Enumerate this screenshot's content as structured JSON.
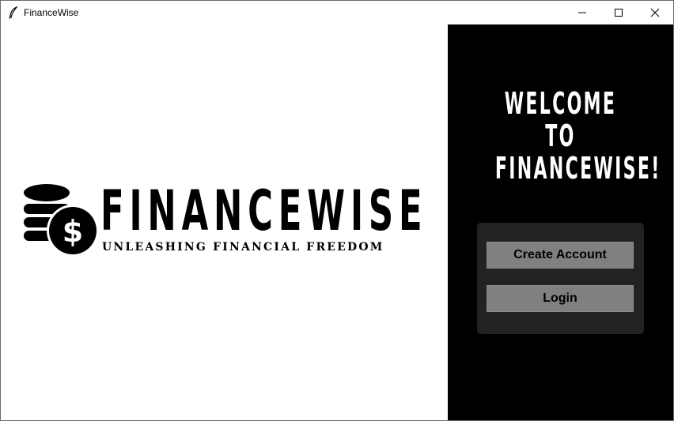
{
  "window": {
    "title": "FinanceWise",
    "app_icon": "feather-icon",
    "controls": {
      "minimize": "minimize-icon",
      "maximize": "maximize-icon",
      "close": "close-icon"
    }
  },
  "logo": {
    "icon": "coins-dollar-icon",
    "icon_symbol": "$",
    "wordmark": "FINANCEWISE",
    "tagline": "UNLEASHING FINANCIAL FREEDOM"
  },
  "welcome": {
    "line1": "WELCOME",
    "line2": "TO",
    "line3": "FINANCEWISE!"
  },
  "actions": {
    "create_account_label": "Create Account",
    "login_label": "Login"
  },
  "colors": {
    "sidebar_bg": "#000000",
    "card_bg": "#222222",
    "button_bg": "#808080",
    "text_light": "#ffffff"
  }
}
